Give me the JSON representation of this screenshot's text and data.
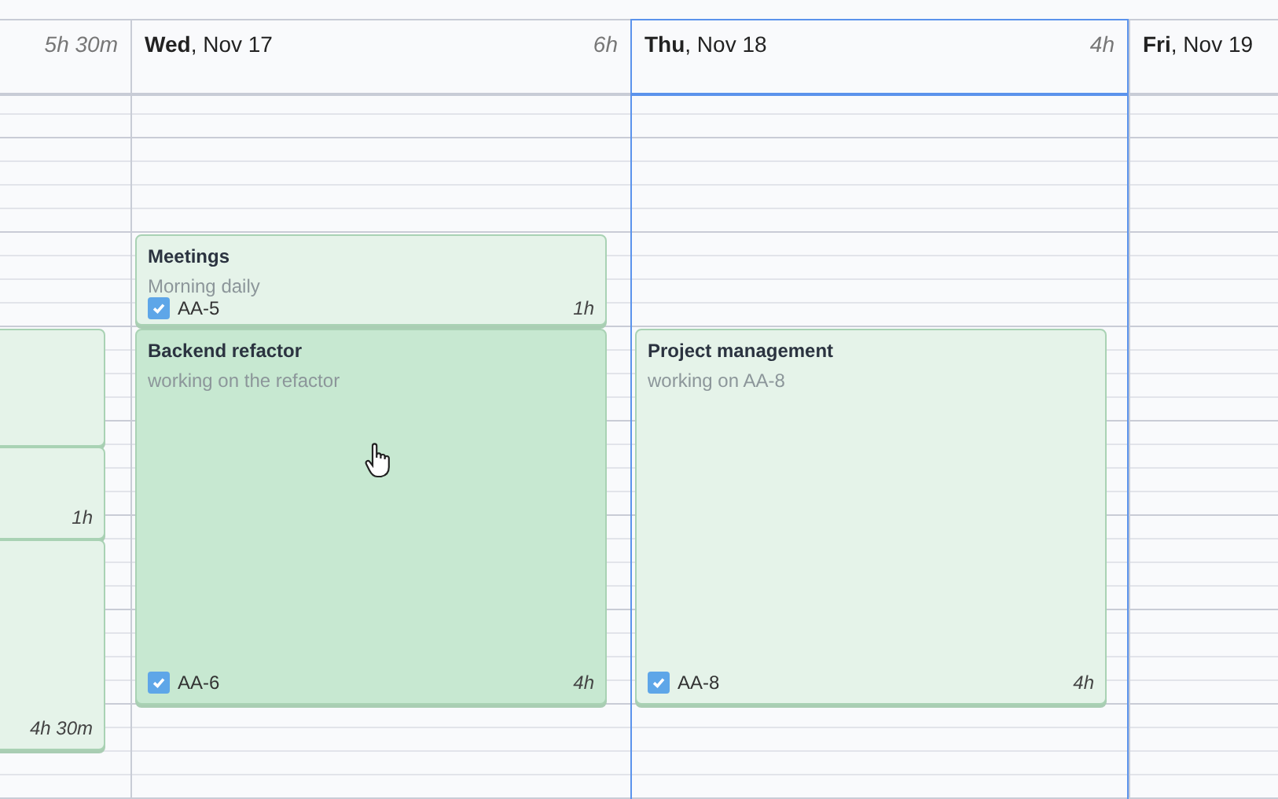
{
  "days": [
    {
      "total": "5h 30m",
      "selected": false,
      "events": [
        {
          "highlighted": false
        },
        {
          "duration": "1h",
          "highlighted": false
        },
        {
          "duration": "4h 30m",
          "highlighted": false
        }
      ]
    },
    {
      "label": "**Wed**, Nov 17",
      "total": "6h",
      "selected": false,
      "events": [
        {
          "title": "Meetings",
          "description": "Morning daily",
          "ticket": "AA-5",
          "checked": true,
          "duration": "1h",
          "highlighted": false
        },
        {
          "title": "Backend refactor",
          "description": "working on the refactor",
          "ticket": "AA-6",
          "checked": true,
          "duration": "4h",
          "highlighted": true
        }
      ]
    },
    {
      "label": "**Thu**, Nov 18",
      "total": "4h",
      "selected": true,
      "events": [
        {
          "title": "Project management",
          "description": "working on AA-8",
          "ticket": "AA-8",
          "checked": true,
          "duration": "4h",
          "highlighted": false
        }
      ]
    },
    {
      "label": "**Fri**, Nov 19",
      "selected": false
    }
  ]
}
